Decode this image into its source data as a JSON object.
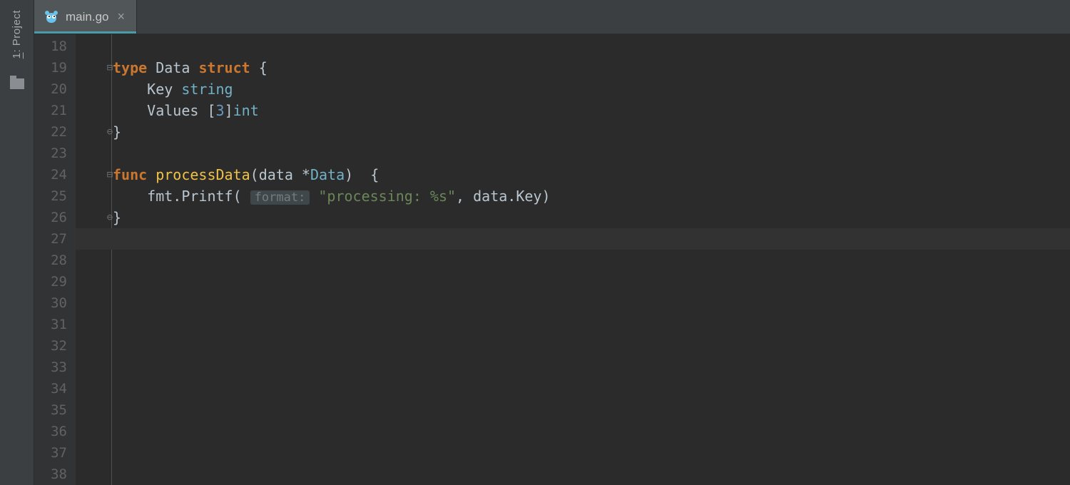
{
  "sidebar": {
    "project_label_prefix": "1",
    "project_label_rest": ": Project"
  },
  "tab": {
    "filename": "main.go",
    "close_glyph": "×"
  },
  "editor": {
    "first_line": 18,
    "last_line": 38,
    "current_line": 27,
    "fold_markers": [
      {
        "line": 19,
        "glyph": "⊟"
      },
      {
        "line": 22,
        "glyph": "⊖"
      },
      {
        "line": 24,
        "glyph": "⊟"
      },
      {
        "line": 26,
        "glyph": "⊖"
      }
    ],
    "lines": {
      "18": {
        "tokens": []
      },
      "19": {
        "tokens": [
          {
            "t": "kw",
            "v": "type"
          },
          {
            "t": "sp",
            "v": " "
          },
          {
            "t": "txt",
            "v": "Data"
          },
          {
            "t": "sp",
            "v": " "
          },
          {
            "t": "kw",
            "v": "struct"
          },
          {
            "t": "sp",
            "v": " "
          },
          {
            "t": "txt",
            "v": "{"
          }
        ]
      },
      "20": {
        "indent": "    ",
        "tokens": [
          {
            "t": "txt",
            "v": "Key"
          },
          {
            "t": "sp",
            "v": " "
          },
          {
            "t": "typ",
            "v": "string"
          }
        ]
      },
      "21": {
        "indent": "    ",
        "tokens": [
          {
            "t": "txt",
            "v": "Values"
          },
          {
            "t": "sp",
            "v": " "
          },
          {
            "t": "txt",
            "v": "["
          },
          {
            "t": "num",
            "v": "3"
          },
          {
            "t": "txt",
            "v": "]"
          },
          {
            "t": "typ",
            "v": "int"
          }
        ]
      },
      "22": {
        "tokens": [
          {
            "t": "txt",
            "v": "}"
          }
        ]
      },
      "23": {
        "tokens": []
      },
      "24": {
        "tokens": [
          {
            "t": "kw",
            "v": "func"
          },
          {
            "t": "sp",
            "v": " "
          },
          {
            "t": "fn",
            "v": "processData"
          },
          {
            "t": "txt",
            "v": "(data *"
          },
          {
            "t": "typ",
            "v": "Data"
          },
          {
            "t": "txt",
            "v": ")  {"
          }
        ]
      },
      "25": {
        "indent": "    ",
        "tokens": [
          {
            "t": "txt",
            "v": "fmt.Printf( "
          },
          {
            "t": "hint",
            "v": "format:"
          },
          {
            "t": "sp",
            "v": " "
          },
          {
            "t": "str",
            "v": "\"processing: %s\""
          },
          {
            "t": "txt",
            "v": ", data.Key)"
          }
        ]
      },
      "26": {
        "tokens": [
          {
            "t": "txt",
            "v": "}"
          }
        ]
      },
      "27": {
        "tokens": []
      },
      "28": {
        "tokens": []
      },
      "29": {
        "tokens": []
      },
      "30": {
        "tokens": []
      },
      "31": {
        "tokens": []
      },
      "32": {
        "tokens": []
      },
      "33": {
        "tokens": []
      },
      "34": {
        "tokens": []
      },
      "35": {
        "tokens": []
      },
      "36": {
        "tokens": []
      },
      "37": {
        "tokens": []
      },
      "38": {
        "tokens": []
      }
    }
  },
  "colors": {
    "background": "#2b2b2b",
    "panel": "#3c3f41",
    "accent": "#4a9aa8",
    "keyword": "#cb772f",
    "type": "#71b2c6",
    "number": "#6a98bd",
    "string": "#6b8659",
    "function": "#f1c244",
    "text": "#b9c6cf"
  }
}
